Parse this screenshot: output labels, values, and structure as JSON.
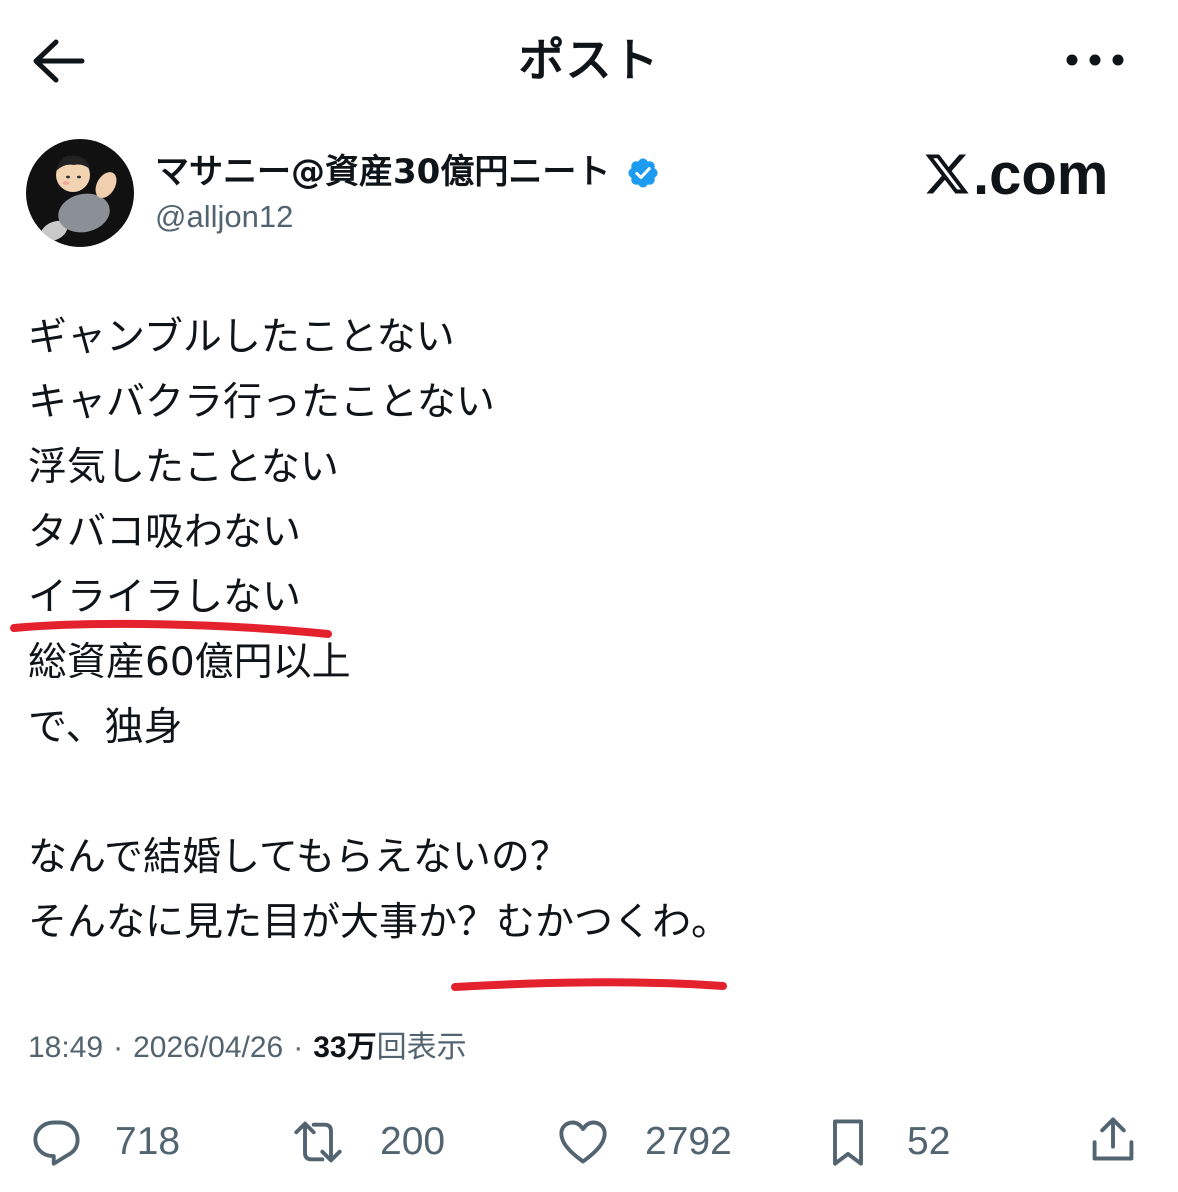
{
  "header": {
    "title": "ポスト",
    "back_icon": "arrow-left-icon",
    "more_icon": "more-horizontal-icon"
  },
  "author": {
    "name": "マサニー@資産30億円ニート",
    "handle": "@alljon12",
    "verified": true,
    "verified_icon": "verified-badge-icon"
  },
  "watermark": {
    "logo_icon": "x-logo-icon",
    "suffix": ".com"
  },
  "post": {
    "paragraphs": [
      [
        "ギャンブルしたことない",
        "キャバクラ行ったことない",
        "浮気したことない",
        "タバコ吸わない",
        "イライラしない",
        "総資産60億円以上",
        "で、独身"
      ],
      [
        "なんで結婚してもらえないの？",
        "そんなに見た目が大事か？むかつくわ。"
      ]
    ],
    "time": "18:49",
    "separator": "·",
    "date": "2026/04/26",
    "views_count": "33万",
    "views_label": "回表示"
  },
  "actions": {
    "reply": {
      "icon": "reply-icon",
      "count": "718"
    },
    "repost": {
      "icon": "repost-icon",
      "count": "200"
    },
    "like": {
      "icon": "heart-icon",
      "count": "2792"
    },
    "bookmark": {
      "icon": "bookmark-icon",
      "count": "52"
    },
    "share": {
      "icon": "share-icon"
    }
  },
  "colors": {
    "text": "#0f1419",
    "secondary": "#536471",
    "verified": "#1d9bf0",
    "annotation": "#e3222e",
    "background": "#ffffff"
  }
}
